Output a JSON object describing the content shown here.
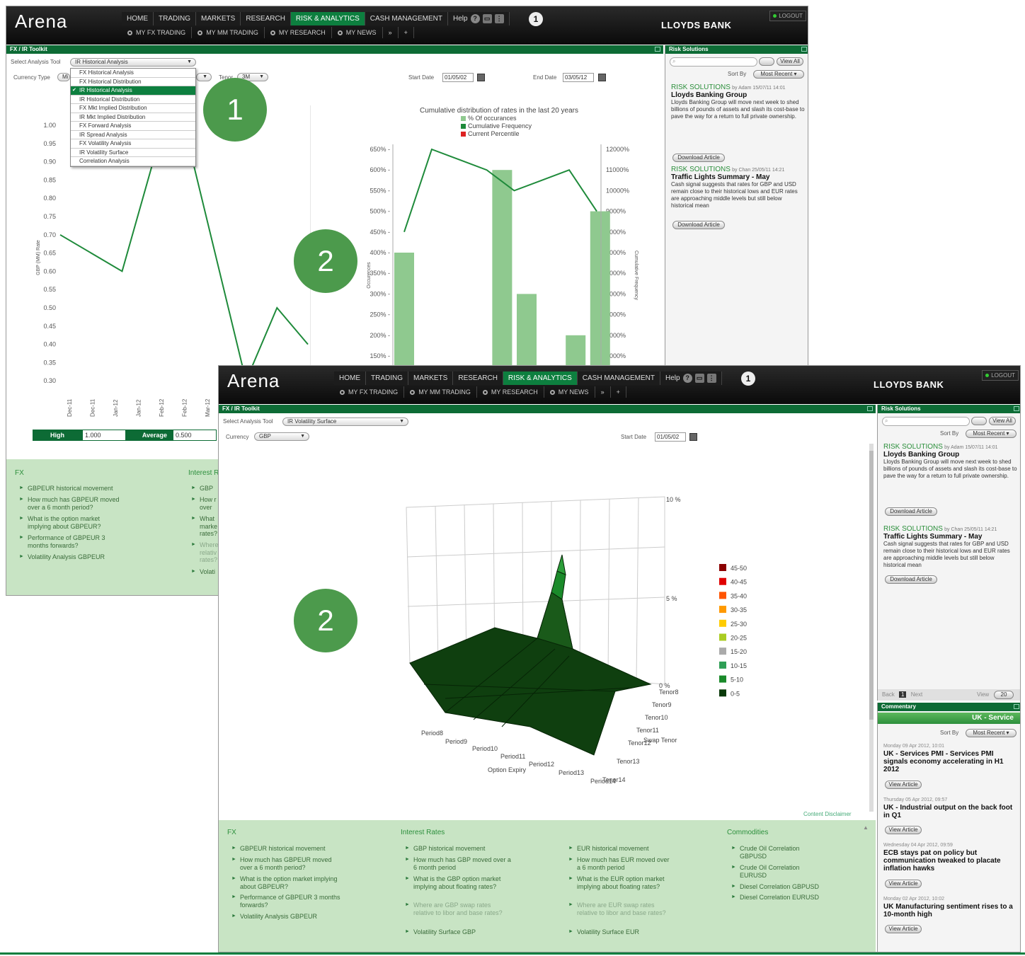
{
  "app": {
    "logo": "Arena",
    "bank": "LLOYDS BANK",
    "logout": "LOGOUT",
    "badge": "1"
  },
  "nav": {
    "main": [
      "HOME",
      "TRADING",
      "MARKETS",
      "RESEARCH",
      "RISK & ANALYTICS",
      "CASH MANAGEMENT"
    ],
    "help": "Help",
    "sub": [
      "MY FX TRADING",
      "MY MM TRADING",
      "MY RESEARCH",
      "MY NEWS"
    ],
    "more": "»",
    "add": "+"
  },
  "window1": {
    "panel_title": "FX / IR Toolkit",
    "tool_label": "Select Analysis Tool",
    "tool_value": "IR Historical Analysis",
    "currency_label": "Currency Type",
    "currency_value": "Mi",
    "tenor_label": "Tenor",
    "tenor_value": "3M",
    "start_label": "Start Date",
    "start_value": "01/05/02",
    "end_label": "End Date",
    "end_value": "03/05/12",
    "dropdown": [
      "FX Historical Analysis",
      "FX Historical Distribution",
      "IR Historical Analysis",
      "IR Historical Distribution",
      "FX Mkt Implied Distribution",
      "IR Mkt Implied Distribution",
      "FX Forward Analysis",
      "IR Spread Analysis",
      "FX Volatility Analysis",
      "IR Volatility Surface",
      "Correlation Analysis"
    ],
    "stats": {
      "high_label": "High",
      "high_value": "1.000",
      "avg_label": "Average",
      "avg_value": "0.500"
    },
    "fx_title": "FX",
    "ir_title": "Interest R",
    "fx_links": [
      "GBPEUR historical movement",
      "How much has GBPEUR moved over a 6 month period?",
      "What is the option market implying about GBPEUR?",
      "Performance of GBPEUR 3 months forwards?",
      "Volatility Analysis GBPEUR"
    ],
    "ir_links": [
      "GBP",
      "How r over",
      "What marke rates?",
      "Where relativ rates?",
      "Volati"
    ],
    "right_title": "Risk Solutions",
    "view_all": "View All",
    "sort_label": "Sort By",
    "sort_value": "Most Recent",
    "articles": [
      {
        "cat": "RISK SOLUTIONS",
        "by": "by Adam 15/07/11 14:01",
        "title": "Lloyds Banking Group",
        "body": "Lloyds Banking Group will move next week to shed billions of pounds of assets and slash its cost-base to pave the way for a return to full private ownership.",
        "button": "Download Article"
      },
      {
        "cat": "RISK SOLUTIONS",
        "by": "by Chan 25/05/11 14:21",
        "title": "Traffic Lights Summary - May",
        "body": "Cash signal suggests that rates for GBP and USD remain close to their historical lows and EUR rates are approaching middle levels but still below historical mean",
        "button": "Download Article"
      }
    ]
  },
  "callouts": [
    "1",
    "2",
    "2"
  ],
  "window2": {
    "panel_title": "FX / IR Toolkit",
    "tool_label": "Select Analysis Tool",
    "tool_value": "IR Volatility Surface",
    "currency_label": "Currency",
    "currency_value": "GBP",
    "start_label": "Start Date",
    "start_value": "01/05/02",
    "disclaimer": "Content Disclaimer",
    "fx_title": "FX",
    "ir_title": "Interest Rates",
    "eur_title": "",
    "com_title": "Commodities",
    "fx_links": [
      "GBPEUR historical movement",
      "How much has GBPEUR moved over a 6 month period?",
      "What is the option market implying about GBPEUR?",
      "Performance of GBPEUR 3 months forwards?",
      "Volatility Analysis GBPEUR"
    ],
    "ir_links": [
      "GBP historical movement",
      "How much has GBP moved over a 6 month period",
      "What is the GBP option market implying about floating rates?",
      "Where are GBP swap rates relative to libor and base rates?",
      "Volatility Surface GBP"
    ],
    "eur_links": [
      "EUR historical movement",
      "How much has EUR moved over a 6 month period",
      "What is the EUR option market implying about floating rates?",
      "Where are EUR swap rates relative to libor and base rates?",
      "Volatility Surface EUR"
    ],
    "com_links": [
      "Crude Oil Correlation GBPUSD",
      "Crude Oil Correlation EURUSD",
      "Diesel Correlation GBPUSD",
      "Diesel Correlation EURUSD"
    ],
    "right_title": "Risk Solutions",
    "view_all": "View All",
    "sort_label": "Sort By",
    "sort_value": "Most Recent",
    "articles": [
      {
        "cat": "RISK SOLUTIONS",
        "by": "by Adam 15/07/11 14:01",
        "title": "Lloyds Banking Group",
        "body": "Lloyds Banking Group will move next week to shed billions of pounds of assets and slash its cost-base to pave the way for a return to full private ownership.",
        "button": "Download Article"
      },
      {
        "cat": "RISK SOLUTIONS",
        "by": "by Chan 25/05/11 14:21",
        "title": "Traffic Lights Summary - May",
        "body": "Cash signal suggests that rates for GBP and USD remain close to their historical lows and EUR rates are approaching middle levels but still below historical mean",
        "button": "Download Article"
      }
    ],
    "pager": {
      "back": "Back",
      "page": "1",
      "next": "Next",
      "view": "View",
      "count": "20"
    },
    "commentary": {
      "title": "Commentary",
      "banner": "UK - Service",
      "sort_label": "Sort By",
      "sort_value": "Most Recent",
      "items": [
        {
          "date": "Monday 09 Apr 2012, 10:01",
          "title": "UK - Services PMI - Services PMI signals economy accelerating in H1 2012",
          "button": "View Article"
        },
        {
          "date": "Thursday 05 Apr 2012, 09:57",
          "title": "UK - Industrial output on the back foot in Q1",
          "button": "View Article"
        },
        {
          "date": "Wednesday 04 Apr 2012, 09:59",
          "title": "ECB stays pat on policy but communication tweaked to placate inflation hawks",
          "button": "View Article"
        },
        {
          "date": "Monday 02 Apr 2012, 10:02",
          "title": "UK Manufacturing sentiment rises to a 10-month high",
          "button": "View Article"
        }
      ]
    }
  },
  "chart_data": [
    {
      "type": "line",
      "title": "",
      "x": [
        "Dec-11",
        "Dec-11",
        "Jan-12",
        "Jan-12",
        "Feb-12",
        "Feb-12",
        "Mar-12",
        "Mar-12"
      ],
      "values": [
        0.7,
        0.65,
        0.6,
        0.9,
        1.0,
        0.65,
        0.3,
        0.5,
        0.4
      ],
      "ylabel": "GBP (MM) Rate",
      "ylim": [
        0.3,
        1.0
      ],
      "yticks": [
        "1.00",
        "0.95",
        "0.90",
        "0.85",
        "0.80",
        "0.75",
        "0.70",
        "0.65",
        "0.60",
        "0.55",
        "0.50",
        "0.45",
        "0.40",
        "0.35",
        "0.30"
      ],
      "color": "#1e8a3a"
    },
    {
      "type": "bar",
      "title": "Cumulative distribution of rates in the last 20 years",
      "legend": [
        "% Of occurances",
        "Cumulative Frequency",
        "Current Percentile"
      ],
      "ylabel": "Occurences",
      "y2label": "Cumulative Frequency",
      "yticks": [
        "650%",
        "600%",
        "550%",
        "500%",
        "450%",
        "400%",
        "350%",
        "300%",
        "250%",
        "200%",
        "150%"
      ],
      "y2ticks": [
        "12000%",
        "11000%",
        "10000%",
        "9000%",
        "8000%",
        "7000%",
        "6000%",
        "5000%",
        "4000%",
        "3000%",
        "2000%"
      ],
      "bars": [
        400,
        0,
        0,
        0,
        600,
        300,
        0,
        200,
        500
      ],
      "line": [
        8000,
        12000,
        11500,
        11000,
        10000,
        10500,
        11000,
        9000
      ],
      "colors": {
        "bar": "#8fc98f",
        "line": "#1e8a3a",
        "current": "#d22"
      }
    },
    {
      "type": "surface",
      "title": "",
      "xlabel": "Option Expiry",
      "ylabel": "Swap Tenor",
      "zticks": [
        "10 %",
        "5 %",
        "0 %"
      ],
      "periods": [
        "Period8",
        "Period9",
        "Period10",
        "Period11",
        "Period12",
        "Period13",
        "Period14"
      ],
      "tenors": [
        "Tenor8",
        "Tenor9",
        "Tenor10",
        "Tenor11",
        "Tenor12",
        "Tenor13",
        "Tenor14"
      ],
      "legend": [
        {
          "label": "45-50",
          "color": "#8b0000"
        },
        {
          "label": "40-45",
          "color": "#e00000"
        },
        {
          "label": "35-40",
          "color": "#ff5500"
        },
        {
          "label": "30-35",
          "color": "#ff9900"
        },
        {
          "label": "25-30",
          "color": "#ffcc00"
        },
        {
          "label": "20-25",
          "color": "#aacc22"
        },
        {
          "label": "15-20",
          "color": "#aaaaaa"
        },
        {
          "label": "10-15",
          "color": "#2e9e55"
        },
        {
          "label": "5-10",
          "color": "#1a8a2a"
        },
        {
          "label": "0-5",
          "color": "#0a3a0a"
        }
      ]
    }
  ]
}
